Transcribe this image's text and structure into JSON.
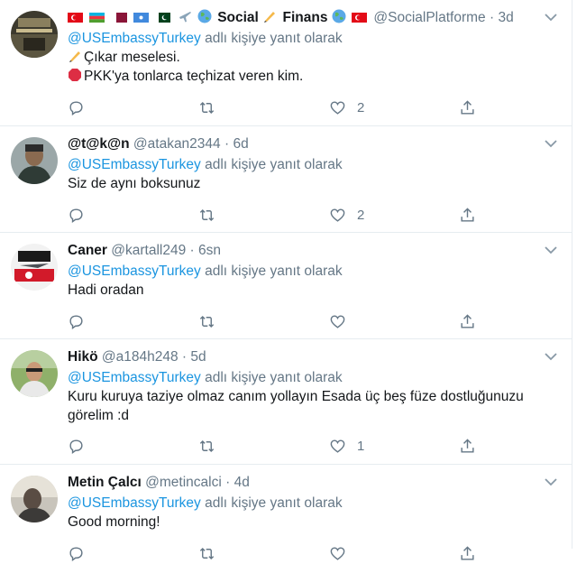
{
  "reply_prefix": "adlı kişiye yanıt olarak",
  "tweets": [
    {
      "display_name": "Social",
      "display_name_2": "Finans",
      "handle": "@SocialPlatforme",
      "time": "3d",
      "mention": "@USEmbassyTurkey",
      "lines": [
        "Çıkar meselesi.",
        "PKK'ya tonlarca teçhizat veren kim."
      ],
      "like_count": "2"
    },
    {
      "display_name": "@t@k@n",
      "handle": "@atakan2344",
      "time": "6d",
      "mention": "@USEmbassyTurkey",
      "lines": [
        "Siz de aynı boksunuz"
      ],
      "like_count": "2"
    },
    {
      "display_name": "Caner",
      "handle": "@kartall249",
      "time": "6sn",
      "mention": "@USEmbassyTurkey",
      "lines": [
        "Hadi oradan"
      ],
      "like_count": ""
    },
    {
      "display_name": "Hikö",
      "handle": "@a184h248",
      "time": "5d",
      "mention": "@USEmbassyTurkey",
      "lines": [
        "Kuru kuruya taziye olmaz canım yollayın Esada üç beş füze dostluğunuzu",
        "görelim :d"
      ],
      "like_count": "1"
    },
    {
      "display_name": "Metin Çalcı",
      "handle": "@metincalci",
      "time": "4d",
      "mention": "@USEmbassyTurkey",
      "lines": [
        "Good morning!"
      ],
      "like_count": ""
    }
  ],
  "colors": {
    "link": "#1b95e0",
    "secondary": "#657786",
    "border": "#e6ecf0",
    "text": "#14171a"
  },
  "icons": [
    "reply-icon",
    "retweet-icon",
    "like-icon",
    "share-icon",
    "chevron-down-icon"
  ]
}
